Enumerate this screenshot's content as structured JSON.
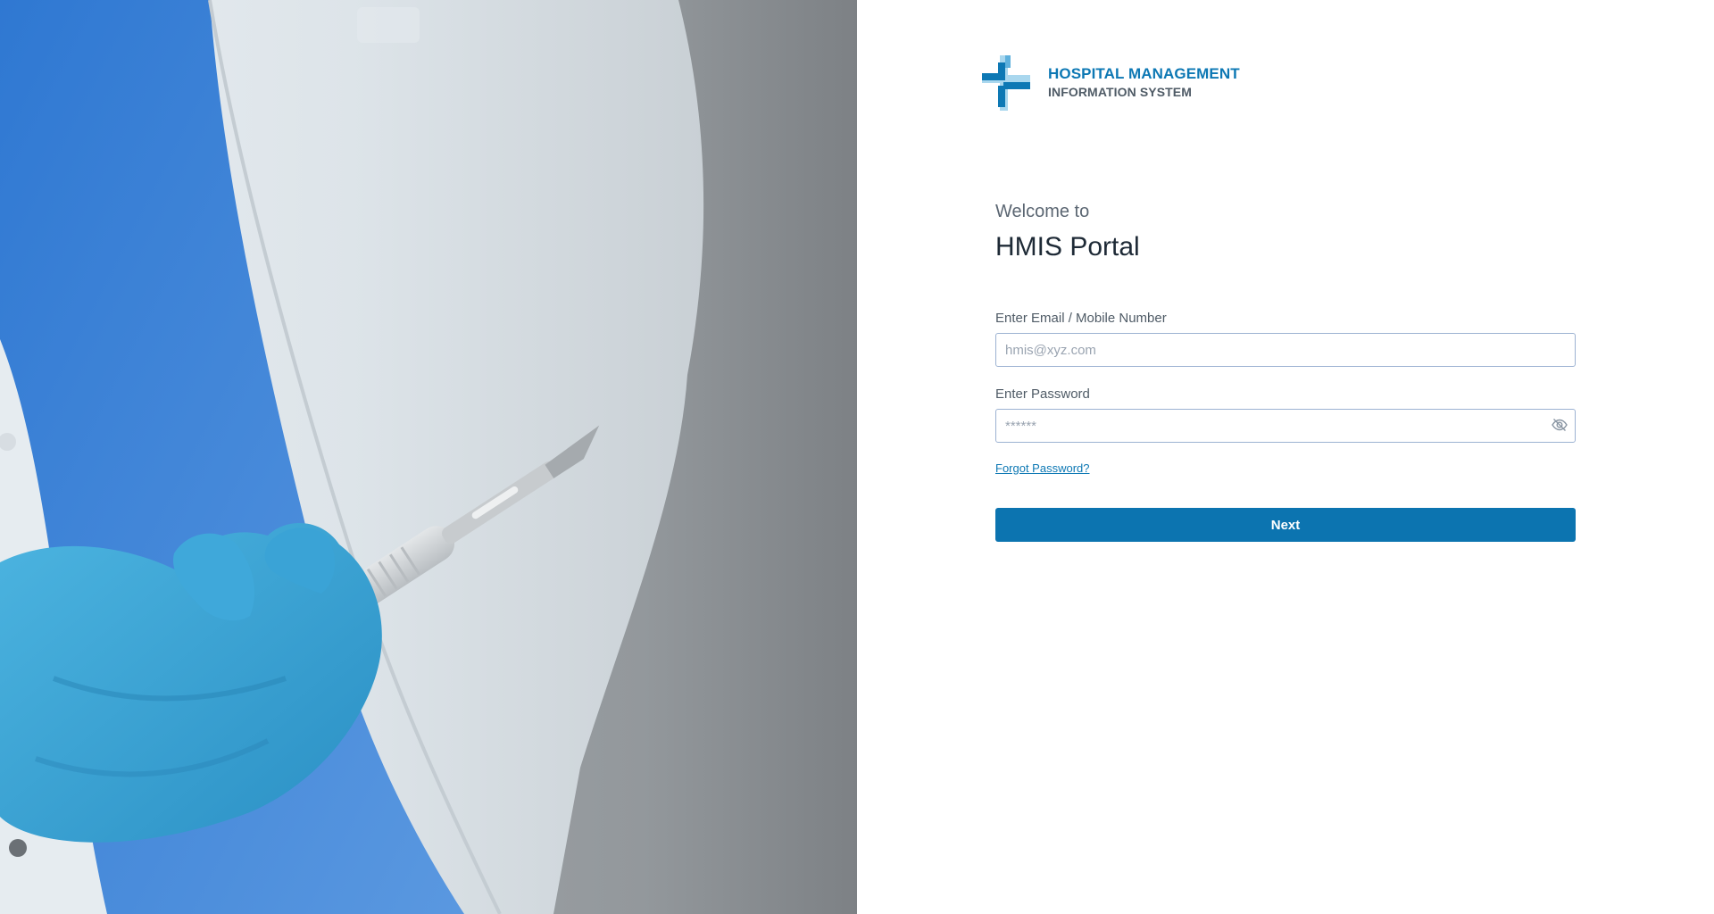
{
  "brand": {
    "name_line1": "HOSPITAL MANAGEMENT",
    "name_line2": "INFORMATION SYSTEM",
    "icon": "medical-cross-logo",
    "color_primary": "#0d78b4",
    "color_secondary": "#4f5b66"
  },
  "hero": {
    "image": "doctor-holding-scalpel-photo"
  },
  "login": {
    "welcome": "Welcome to",
    "title": "HMIS Portal",
    "email_label": "Enter Email / Mobile Number",
    "email_placeholder": "hmis@xyz.com",
    "email_value": "",
    "password_label": "Enter Password",
    "password_placeholder": "******",
    "password_value": "",
    "password_toggle_icon": "eye-slash-icon",
    "forgot_label": "Forgot Password?",
    "next_label": "Next"
  },
  "colors": {
    "accent": "#0c74b0",
    "input_border": "#9cb2d2",
    "heading": "#1e2a36",
    "muted_text": "#5b6672"
  }
}
